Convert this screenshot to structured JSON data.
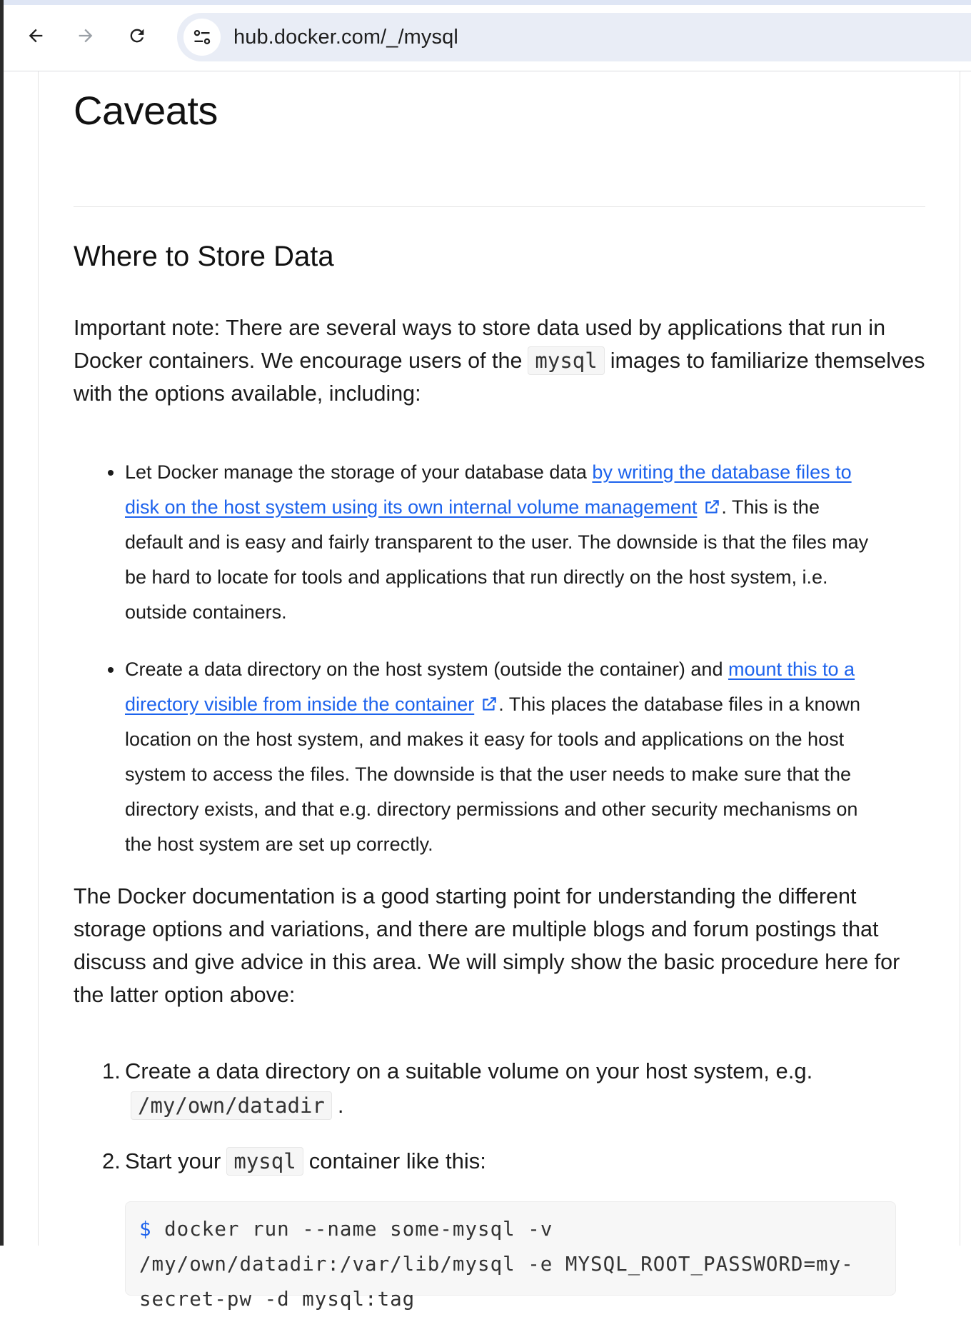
{
  "browser": {
    "url": "hub.docker.com/_/mysql"
  },
  "article": {
    "h1": "Caveats",
    "h2": "Where to Store Data",
    "intro": {
      "before": "Important note: There are several ways to store data used by applications that run in Docker containers. We encourage users of the",
      "code": "mysql",
      "after": "images to familiarize themselves with the options available, including:"
    },
    "bullets": [
      {
        "before": "Let Docker manage the storage of your database data ",
        "link": "by writing the database files to disk on the host system using its own internal volume management",
        "after": ". This is the default and is easy and fairly transparent to the user. The downside is that the files may be hard to locate for tools and applications that run directly on the host system, i.e. outside containers."
      },
      {
        "before": "Create a data directory on the host system (outside the container) and ",
        "link": "mount this to a directory visible from inside the container",
        "after": ". This places the database files in a known location on the host system, and makes it easy for tools and applications on the host system to access the files. The downside is that the user needs to make sure that the directory exists, and that e.g. directory permissions and other security mechanisms on the host system are set up correctly."
      }
    ],
    "para2": "The Docker documentation is a good starting point for understanding the different storage options and variations, and there are multiple blogs and forum postings that discuss and give advice in this area. We will simply show the basic procedure here for the latter option above:",
    "steps": [
      {
        "num": "1.",
        "before": "Create a data directory on a suitable volume on your host system, e.g.",
        "code": "/my/own/datadir",
        "after": "."
      },
      {
        "num": "2.",
        "before": "Start your",
        "code": "mysql",
        "after": "container like this:"
      }
    ],
    "code_block": {
      "prompt": "$",
      "command": "docker run --name some-mysql -v /my/own/datadir:/var/lib/mysql -e MYSQL_ROOT_PASSWORD=my-secret-pw -d mysql:tag"
    }
  }
}
